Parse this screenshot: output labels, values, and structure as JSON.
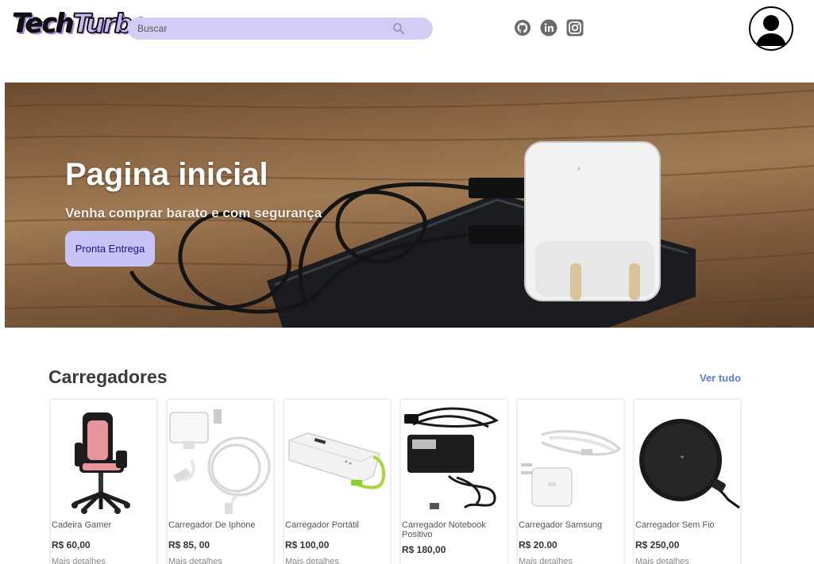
{
  "header": {
    "logo_part1": "Tech",
    "logo_part2": "Turbo",
    "search_placeholder": "Buscar",
    "social_icons": [
      "github-icon",
      "linkedin-icon",
      "instagram-icon"
    ],
    "avatar_icon": "user-icon"
  },
  "hero": {
    "title": "Pagina inicial",
    "subtitle": "Venha comprar barato e com segurança",
    "button_label": "Pronta Entrega"
  },
  "section": {
    "title": "Carregadores",
    "see_all": "Ver tudo"
  },
  "products": [
    {
      "name": "Cadeira Gamer",
      "price": "R$ 60,00",
      "more": "Mais detalhes"
    },
    {
      "name": "Carregador De Iphone",
      "price": "R$ 85, 00",
      "more": "Mais detalhes"
    },
    {
      "name": "Carregador Portátil",
      "price": "R$ 100,00",
      "more": "Mais detalhes"
    },
    {
      "name": "Carregador Notebook Positivo",
      "price": "R$ 180,00",
      "more": "Mais detalhes"
    },
    {
      "name": "Carregador Samsung",
      "price": "R$ 20.00",
      "more": "Mais detalhes"
    },
    {
      "name": "Carregador Sem Fio",
      "price": "R$ 250,00",
      "more": "Mais detalhes"
    }
  ],
  "colors": {
    "search_bg": "#d3cdf5",
    "button_bg": "#c8c3f6",
    "button_text": "#16108a",
    "link": "#5b7fcf"
  }
}
